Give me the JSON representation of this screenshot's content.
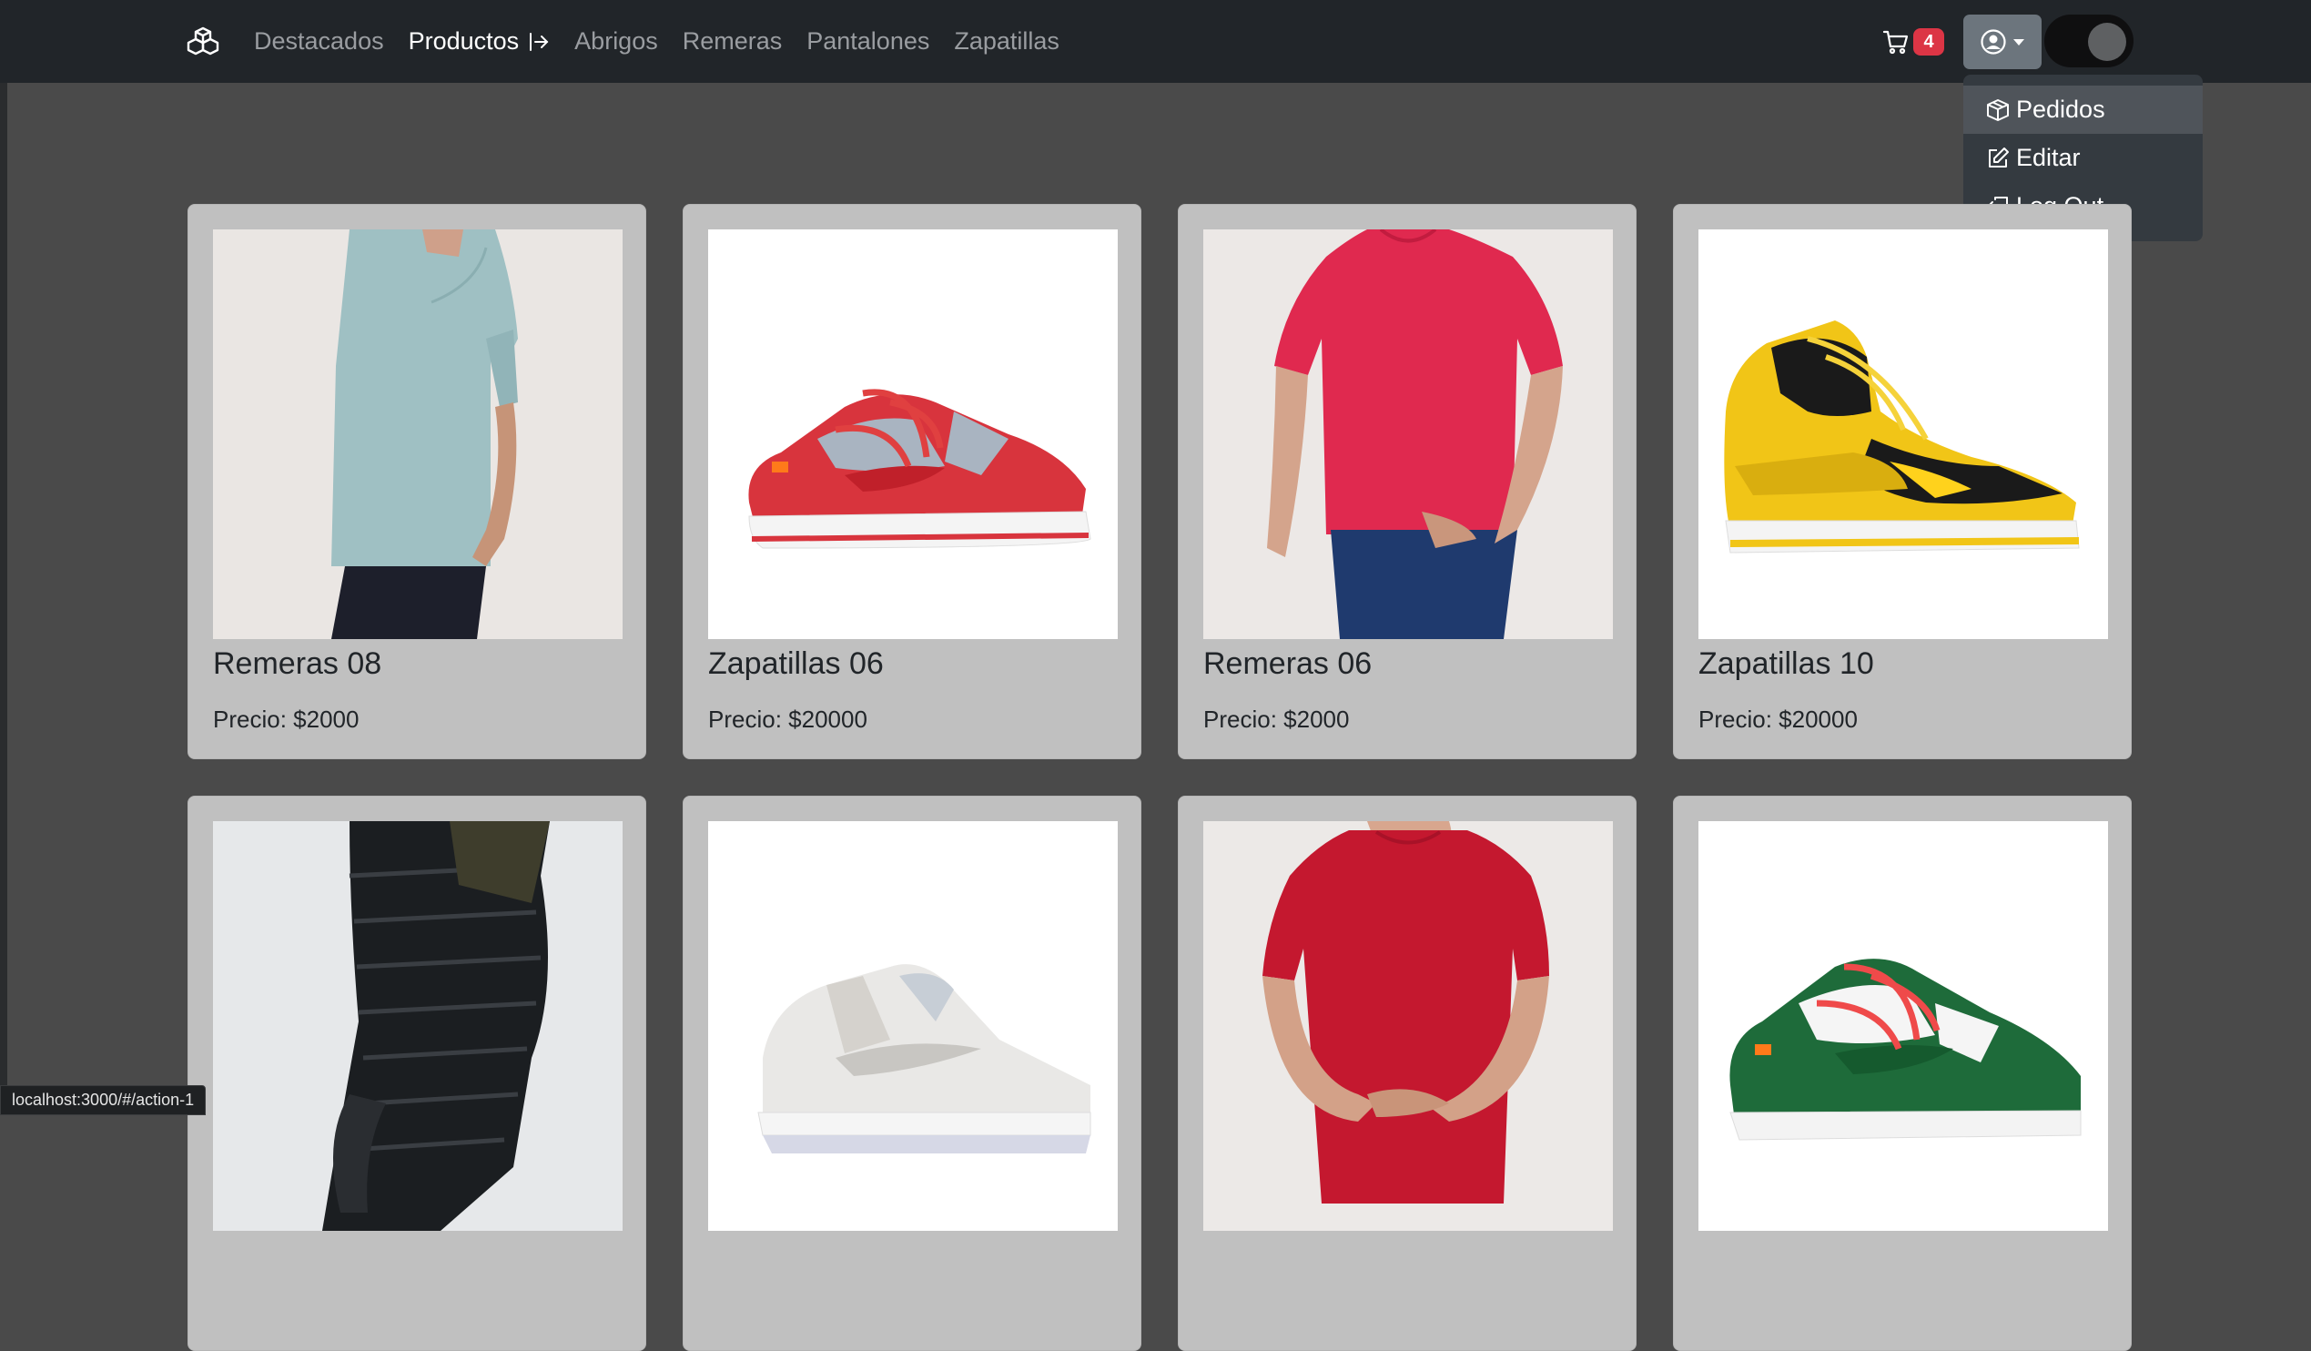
{
  "nav": {
    "links": [
      {
        "label": "Destacados",
        "active": false
      },
      {
        "label": "Productos",
        "active": true
      },
      {
        "label": "Abrigos",
        "active": false
      },
      {
        "label": "Remeras",
        "active": false
      },
      {
        "label": "Pantalones",
        "active": false
      },
      {
        "label": "Zapatillas",
        "active": false
      }
    ],
    "cart_count": "4"
  },
  "user_menu": {
    "items": [
      {
        "label": "Pedidos",
        "icon": "box-icon"
      },
      {
        "label": "Editar",
        "icon": "pencil-square-icon"
      },
      {
        "label": "Log Out",
        "icon": "logout-icon"
      }
    ]
  },
  "products": [
    {
      "name": "Remeras 08",
      "price": "Precio: $2000",
      "kind": "tshirt-lightblue"
    },
    {
      "name": "Zapatillas 06",
      "price": "Precio: $20000",
      "kind": "sneaker-red"
    },
    {
      "name": "Remeras 06",
      "price": "Precio: $2000",
      "kind": "tshirt-red"
    },
    {
      "name": "Zapatillas 10",
      "price": "Precio: $20000",
      "kind": "sneaker-yellow"
    },
    {
      "name": "",
      "price": "",
      "kind": "jacket-black"
    },
    {
      "name": "",
      "price": "",
      "kind": "sneaker-white"
    },
    {
      "name": "",
      "price": "",
      "kind": "tshirt-darkred"
    },
    {
      "name": "",
      "price": "",
      "kind": "sneaker-green"
    }
  ],
  "status_url": "localhost:3000/#/action-1",
  "colors": {
    "navbar": "#212529",
    "background": "#4a4a4a",
    "card": "#c0c0c0",
    "badge": "#dc3545",
    "dropdown": "#343a40"
  }
}
